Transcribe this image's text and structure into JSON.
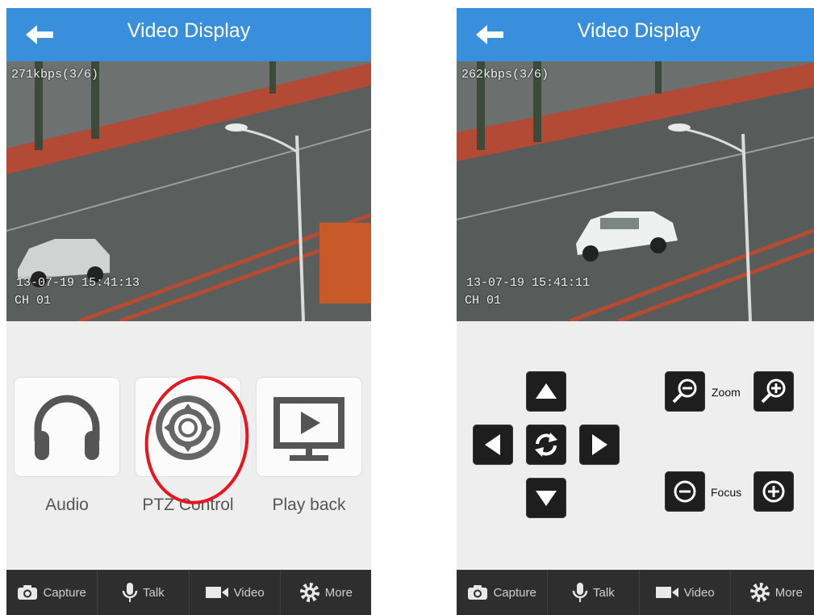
{
  "left": {
    "title": "Video Display",
    "osd": {
      "rate": "271kbps(3/6)",
      "time": "13-07-19 15:41:13",
      "channel": "CH 01"
    },
    "features": [
      {
        "label": "Audio",
        "icon": "headphones-icon"
      },
      {
        "label": "PTZ Control",
        "icon": "ptz-dpad-icon"
      },
      {
        "label": "Play back",
        "icon": "monitor-play-icon"
      }
    ],
    "highlight_color": "#e8141e"
  },
  "right": {
    "title": "Video Display",
    "osd": {
      "rate": "262kbps(3/6)",
      "time": "13-07-19 15:41:11",
      "channel": "CH 01"
    },
    "ptz": {
      "zoom_label": "Zoom",
      "focus_label": "Focus"
    }
  },
  "tabs": [
    {
      "label": "Capture",
      "icon": "camera-icon"
    },
    {
      "label": "Talk",
      "icon": "microphone-icon"
    },
    {
      "label": "Video",
      "icon": "video-camera-icon"
    },
    {
      "label": "More",
      "icon": "gear-icon"
    }
  ],
  "colors": {
    "titlebar": "#3a8fdc",
    "tabbar": "#2e2e2e",
    "button": "#1e1e1e"
  }
}
